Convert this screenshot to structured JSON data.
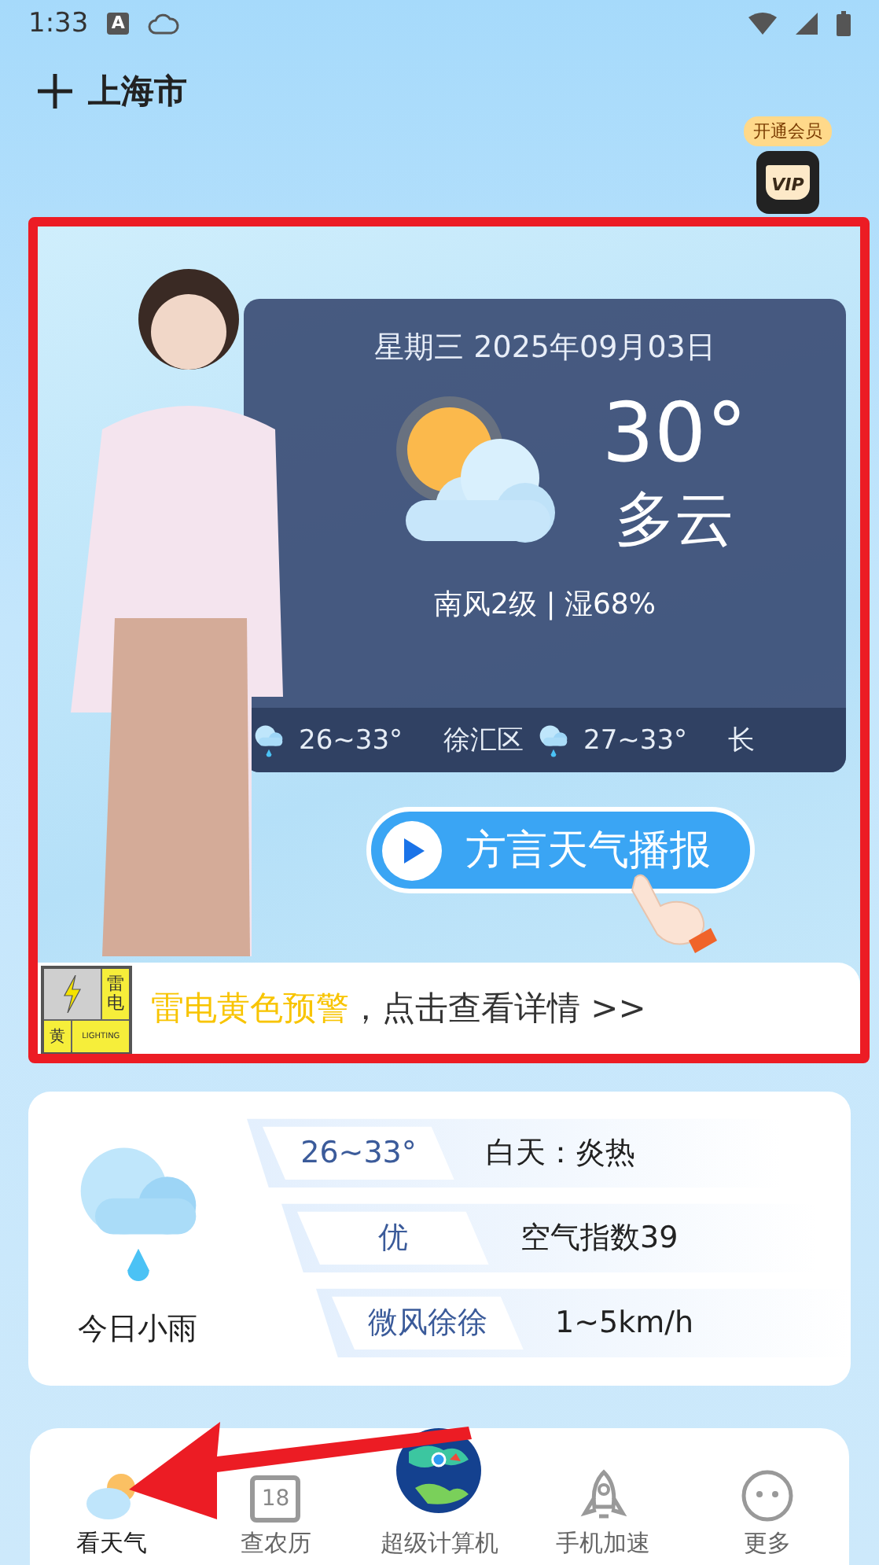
{
  "status_bar": {
    "time": "1:33",
    "notice_letter": "A"
  },
  "header": {
    "city": "上海市",
    "vip_label": "开通会员",
    "vip_icon_text": "VIP"
  },
  "broadcast": {
    "date": "星期三 2025年09月03日",
    "temperature": "30°",
    "condition": "多云",
    "wind_humidity": "南风2级 | 湿68%",
    "districts": [
      {
        "kind": "rain",
        "range": "26~33°"
      },
      {
        "kind": "rain",
        "name": "徐汇区",
        "range": "27~33°"
      },
      {
        "kind": "text",
        "name": "长"
      }
    ],
    "play_button": "方言天气播报"
  },
  "alert": {
    "badge_top": "雷电",
    "badge_level": "黄",
    "badge_en": "LIGHTING",
    "title": "雷电黄色预警",
    "link": "，点击查看详情 >>"
  },
  "today": {
    "summary": "今日小雨",
    "rows": [
      {
        "tag": "26~33°",
        "value": "白天：炎热"
      },
      {
        "tag": "优",
        "value": "空气指数39"
      },
      {
        "tag": "微风徐徐",
        "value": "1~5km/h"
      }
    ]
  },
  "nav": [
    {
      "kind": "weather",
      "label": "看天气",
      "selected": true
    },
    {
      "kind": "calendar",
      "label": "查农历",
      "selected": false,
      "icon_text": "18"
    },
    {
      "kind": "globe",
      "label": "超级计算机",
      "selected": false
    },
    {
      "kind": "rocket",
      "label": "手机加速",
      "selected": false
    },
    {
      "kind": "face",
      "label": "更多",
      "selected": false
    }
  ]
}
